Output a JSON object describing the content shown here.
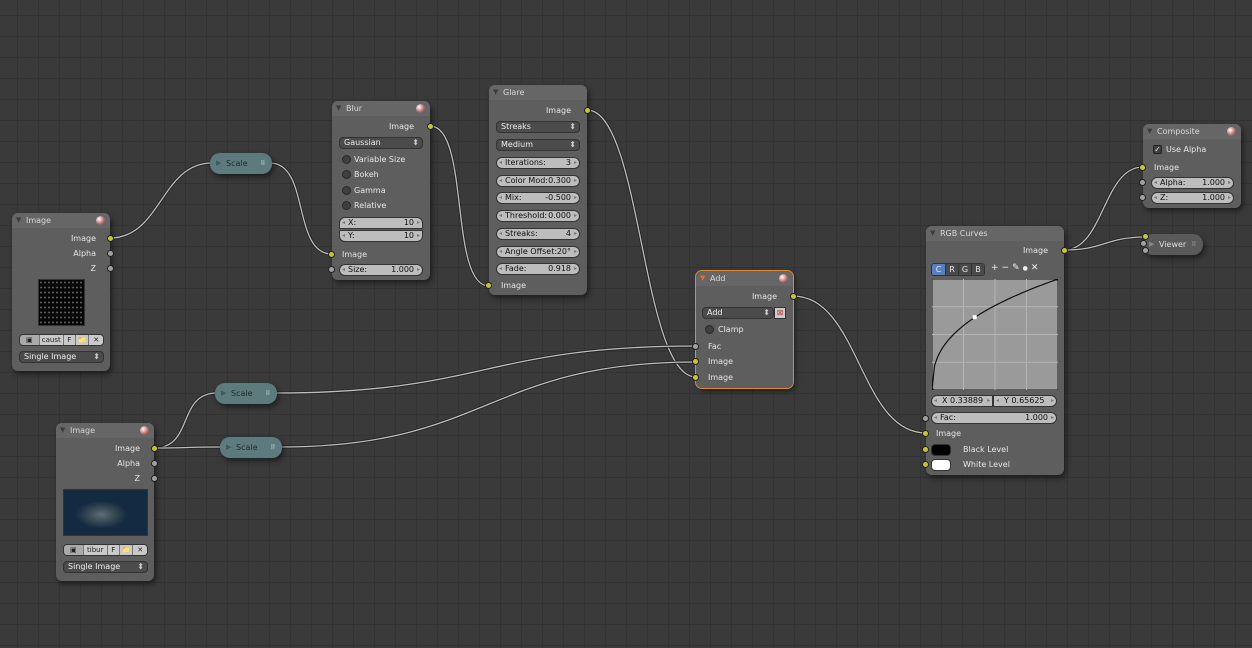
{
  "image_node_1": {
    "title": "Image",
    "outputs": [
      "Image",
      "Alpha",
      "Z"
    ],
    "image_name": "caust",
    "f": "F",
    "source": "Single Image"
  },
  "image_node_2": {
    "title": "Image",
    "outputs": [
      "Image",
      "Alpha",
      "Z"
    ],
    "image_name": "tibur",
    "f": "F",
    "source": "Single Image"
  },
  "scale_nodes": [
    {
      "title": "Scale"
    },
    {
      "title": "Scale"
    },
    {
      "title": "Scale"
    }
  ],
  "blur": {
    "title": "Blur",
    "output": "Image",
    "filter": "Gaussian",
    "options": [
      "Variable Size",
      "Bokeh",
      "Gamma",
      "Relative"
    ],
    "x_label": "X:",
    "x": "10",
    "y_label": "Y:",
    "y": "10",
    "input": "Image",
    "size_label": "Size:",
    "size": "1.000"
  },
  "glare": {
    "title": "Glare",
    "output": "Image",
    "type": "Streaks",
    "quality": "Medium",
    "fields": [
      {
        "label": "Iterations:",
        "value": "3"
      },
      {
        "label": "Color Mod:",
        "value": "0.300"
      },
      {
        "label": "Mix:",
        "value": "-0.500"
      },
      {
        "label": "Threshold:",
        "value": "0.000"
      },
      {
        "label": "Streaks:",
        "value": "4"
      },
      {
        "label": "Angle Offset:",
        "value": "20°"
      },
      {
        "label": "Fade:",
        "value": "0.918"
      }
    ],
    "input": "Image"
  },
  "add": {
    "title": "Add",
    "output": "Image",
    "blend": "Add",
    "clamp": "Clamp",
    "inputs": [
      "Fac",
      "Image",
      "Image"
    ]
  },
  "curves": {
    "title": "RGB Curves",
    "output": "Image",
    "channels": [
      "C",
      "R",
      "G",
      "B"
    ],
    "active_channel": "C",
    "tools": [
      "+",
      "−",
      "✎",
      "●",
      "✕"
    ],
    "point_x": "X 0.33889",
    "point_y": "Y 0.65625",
    "point": [
      0.33889,
      0.65625
    ],
    "fac_label": "Fac:",
    "fac": "1.000",
    "input": "Image",
    "black": "Black Level",
    "white": "White Level"
  },
  "composite": {
    "title": "Composite",
    "use_alpha": "Use Alpha",
    "input": "Image",
    "alpha_label": "Alpha:",
    "alpha": "1.000",
    "z_label": "Z:",
    "z": "1.000"
  },
  "viewer": {
    "title": "Viewer"
  },
  "colors": {
    "socket_image": "#c7c729",
    "socket_value": "#a1a1a1",
    "scale_node": "#5d7b7c",
    "selected_outline": "#e08b2e"
  }
}
